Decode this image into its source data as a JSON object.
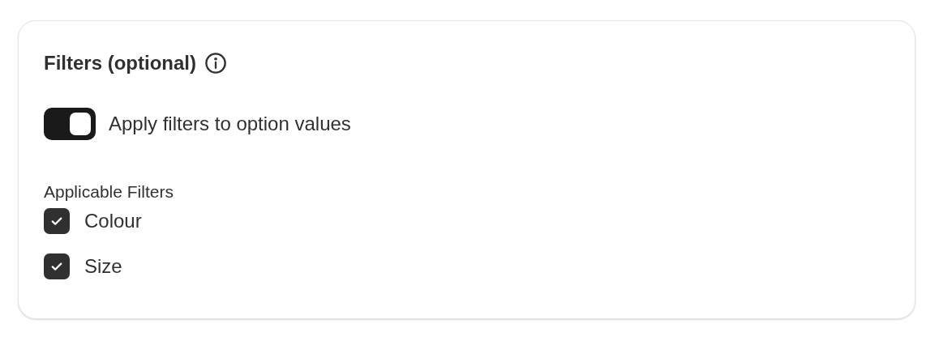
{
  "card": {
    "title": "Filters (optional)",
    "toggle": {
      "label": "Apply filters to option values",
      "on": true
    },
    "filters_heading": "Applicable Filters",
    "filters": [
      {
        "label": "Colour",
        "checked": true
      },
      {
        "label": "Size",
        "checked": true
      }
    ]
  }
}
